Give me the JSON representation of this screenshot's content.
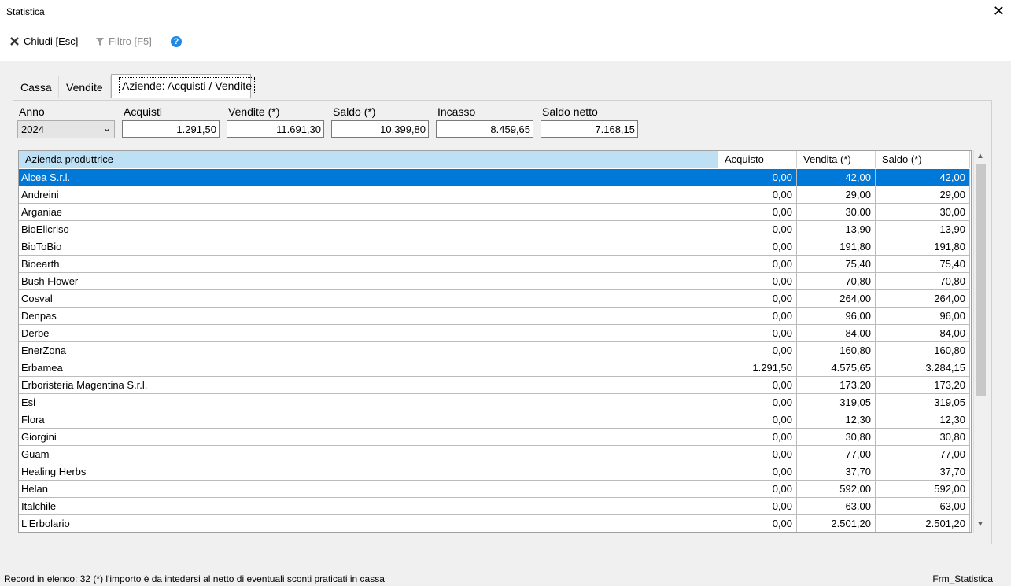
{
  "window": {
    "title": "Statistica",
    "close_glyph": "✕"
  },
  "toolbar": {
    "close_label": "Chiudi [Esc]",
    "filter_label": "Filtro [F5]",
    "help_glyph": "?"
  },
  "tabs": [
    "Cassa",
    "Vendite",
    "Aziende: Acquisti / Vendite"
  ],
  "filters": {
    "anno_label": "Anno",
    "anno_value": "2024",
    "acquisti_label": "Acquisti",
    "acquisti_value": "1.291,50",
    "vendite_label": "Vendite (*)",
    "vendite_value": "11.691,30",
    "saldo_label": "Saldo (*)",
    "saldo_value": "10.399,80",
    "incasso_label": "Incasso",
    "incasso_value": "8.459,65",
    "saldo_netto_label": "Saldo netto",
    "saldo_netto_value": "7.168,15"
  },
  "table": {
    "columns": [
      "Azienda produttrice",
      "Acquisto",
      "Vendita (*)",
      "Saldo (*)"
    ],
    "rows": [
      [
        "Alcea S.r.l.",
        "0,00",
        "42,00",
        "42,00"
      ],
      [
        "Andreini",
        "0,00",
        "29,00",
        "29,00"
      ],
      [
        "Arganiae",
        "0,00",
        "30,00",
        "30,00"
      ],
      [
        "BioElicriso",
        "0,00",
        "13,90",
        "13,90"
      ],
      [
        "BioToBio",
        "0,00",
        "191,80",
        "191,80"
      ],
      [
        "Bioearth",
        "0,00",
        "75,40",
        "75,40"
      ],
      [
        "Bush Flower",
        "0,00",
        "70,80",
        "70,80"
      ],
      [
        "Cosval",
        "0,00",
        "264,00",
        "264,00"
      ],
      [
        "Denpas",
        "0,00",
        "96,00",
        "96,00"
      ],
      [
        "Derbe",
        "0,00",
        "84,00",
        "84,00"
      ],
      [
        "EnerZona",
        "0,00",
        "160,80",
        "160,80"
      ],
      [
        "Erbamea",
        "1.291,50",
        "4.575,65",
        "3.284,15"
      ],
      [
        "Erboristeria Magentina S.r.l.",
        "0,00",
        "173,20",
        "173,20"
      ],
      [
        "Esi",
        "0,00",
        "319,05",
        "319,05"
      ],
      [
        "Flora",
        "0,00",
        "12,30",
        "12,30"
      ],
      [
        "Giorgini",
        "0,00",
        "30,80",
        "30,80"
      ],
      [
        "Guam",
        "0,00",
        "77,00",
        "77,00"
      ],
      [
        "Healing Herbs",
        "0,00",
        "37,70",
        "37,70"
      ],
      [
        "Helan",
        "0,00",
        "592,00",
        "592,00"
      ],
      [
        "Italchile",
        "0,00",
        "63,00",
        "63,00"
      ],
      [
        "L'Erbolario",
        "0,00",
        "2.501,20",
        "2.501,20"
      ]
    ],
    "selected_index": 0
  },
  "status": {
    "left": "Record in elenco: 32  (*) l'importo è da intedersi al netto di eventuali sconti praticati in cassa",
    "right": "Frm_Statistica"
  },
  "colors": {
    "selection": "#0078d7",
    "header": "#bde0f5",
    "help": "#1e88e5"
  }
}
